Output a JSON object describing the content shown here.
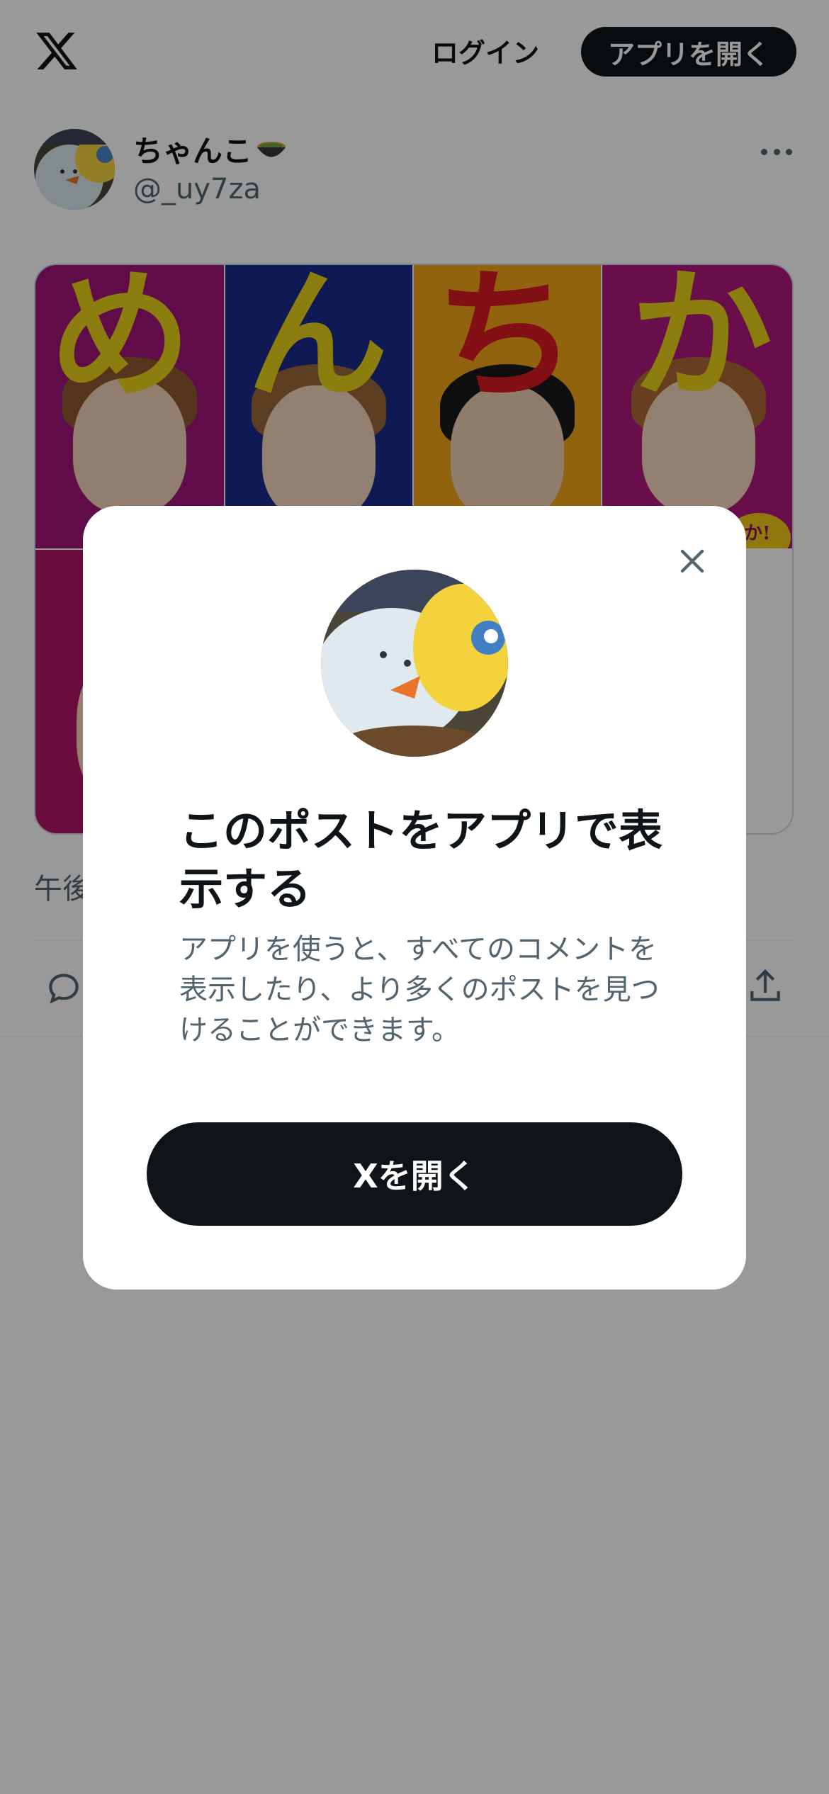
{
  "header": {
    "logo_icon": "x-logo-icon",
    "login_label": "ログイン",
    "open_app_label": "アプリを開く"
  },
  "post": {
    "display_name": "ちゃんこ",
    "name_emoji_icon": "bowl-icon",
    "handle": "@_uy7za",
    "more_icon": "more-icon",
    "media_title_chars": [
      "め",
      "ん",
      "ち",
      "か"
    ],
    "media_subtext": "か!",
    "timestamp_partial": "午後",
    "reply_icon": "reply-icon",
    "share_icon": "share-icon"
  },
  "modal": {
    "title": "このポストをアプリで表示する",
    "body": "アプリを使うと、すべてのコメントを表示したり、より多くのポストを見つけることができます。",
    "button_label": "Xを開く",
    "close_icon": "close-icon"
  },
  "colors": {
    "text_primary": "#0f1419",
    "text_secondary": "#536471",
    "button_dark": "#0f1419",
    "overlay": "rgba(0,0,0,0.4)",
    "panel_magenta": "#a0157a",
    "panel_blue": "#1a2a8c",
    "panel_orange": "#f2a618",
    "panel_magenta_2": "#b0167e",
    "title_yellow": "#e8d21a",
    "title_red": "#d71920"
  }
}
